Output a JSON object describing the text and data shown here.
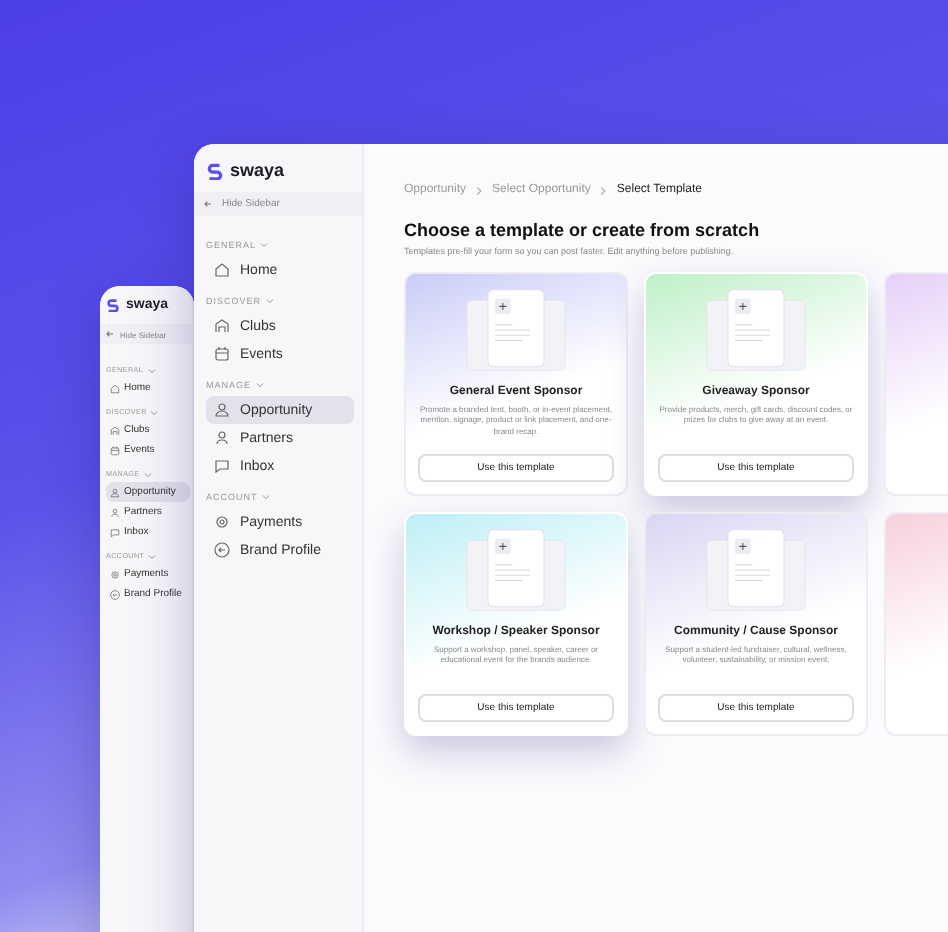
{
  "windows": [
    {
      "logo": "swaya",
      "hide_sidebar": "Hide Sidebar",
      "sections": [
        {
          "title": "GENERAL",
          "items": [
            {
              "label": "Home",
              "selected": false
            }
          ]
        },
        {
          "title": "DISCOVER",
          "items": [
            {
              "label": "Clubs",
              "selected": false
            },
            {
              "label": "Events",
              "selected": false
            }
          ]
        },
        {
          "title": "MANAGE",
          "items": [
            {
              "label": "Opportunity",
              "selected": true
            },
            {
              "label": "Partners",
              "selected": false
            },
            {
              "label": "Inbox",
              "selected": false
            }
          ]
        },
        {
          "title": "ACCOUNT",
          "items": [
            {
              "label": "Payments",
              "selected": false
            },
            {
              "label": "Brand Profile",
              "selected": false
            }
          ]
        }
      ]
    },
    {
      "logo": "swaya",
      "hide_sidebar": "Hide Sidebar",
      "sections": [
        {
          "title": "GENERAL",
          "items": [
            {
              "label": "Home",
              "selected": false
            }
          ]
        },
        {
          "title": "DISCOVER",
          "items": [
            {
              "label": "Clubs",
              "selected": false
            },
            {
              "label": "Events",
              "selected": false
            }
          ]
        },
        {
          "title": "MANAGE",
          "items": [
            {
              "label": "Opportunity",
              "selected": true
            },
            {
              "label": "Partners",
              "selected": false
            },
            {
              "label": "Inbox",
              "selected": false
            }
          ]
        },
        {
          "title": "ACCOUNT",
          "items": [
            {
              "label": "Payments",
              "selected": false
            },
            {
              "label": "Brand Profile",
              "selected": false
            }
          ]
        }
      ]
    }
  ],
  "main": {
    "breadcrumb": [
      "Opportunity",
      "Select Opportunity",
      "Select Template"
    ],
    "heading": "Choose a template or create from scratch",
    "subheading": "Templates pre-fill your form so you can post faster. Edit anything before publishing.",
    "templates": [
      {
        "title": "General Event Sponsor",
        "description": "Promote a branded tent, booth, or in-event placement, mention, signage, product or link placement, and one-brand recap.",
        "button": "Use this template",
        "highlighted": false,
        "color": "#c9ccf7"
      },
      {
        "title": "Giveaway Sponsor",
        "description": "Provide products, merch, gift cards, discount codes, or prizes for clubs to give away at an event.",
        "button": "Use this template",
        "highlighted": true,
        "color": "#bff0c8"
      },
      {
        "highlighted": false,
        "color": "#e6d0f7"
      },
      {
        "title": "Workshop / Speaker Sponsor",
        "description": "Support a workshop, panel, speaker, career or educational event for the brands audience.",
        "button": "Use this template",
        "highlighted": true,
        "color": "#bdeff5"
      },
      {
        "title": "Community / Cause Sponsor",
        "description": "Support a student-led fundraiser, cultural, wellness, volunteer, sustainability, or mission event.",
        "button": "Use this template",
        "highlighted": false,
        "color": "#d8d6f2"
      },
      {
        "highlighted": false,
        "color": "#f7d0dc"
      }
    ]
  }
}
